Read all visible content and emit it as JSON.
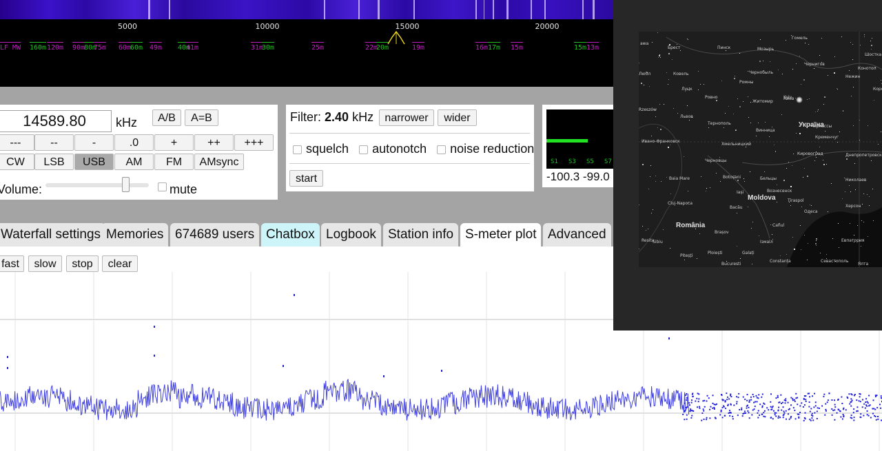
{
  "spectrum": {
    "scale_labels": [
      {
        "freq_khz": 5000,
        "label": "5000"
      },
      {
        "freq_khz": 10000,
        "label": "10000"
      },
      {
        "freq_khz": 15000,
        "label": "15000"
      },
      {
        "freq_khz": 20000,
        "label": "20000"
      }
    ],
    "band_labels": [
      {
        "text": "LF MW",
        "color": "magenta"
      },
      {
        "text": "160m",
        "color": "green"
      },
      {
        "text": "120m",
        "color": "magenta"
      },
      {
        "text": "90m",
        "color": "magenta"
      },
      {
        "text": "80m",
        "color": "green"
      },
      {
        "text": "75m",
        "color": "magenta"
      },
      {
        "text": "60m",
        "color": "magenta"
      },
      {
        "text": "60m",
        "color": "green"
      },
      {
        "text": "49m",
        "color": "magenta"
      },
      {
        "text": "40m",
        "color": "green"
      },
      {
        "text": "41m",
        "color": "magenta"
      },
      {
        "text": "31m",
        "color": "magenta"
      },
      {
        "text": "30m",
        "color": "green"
      },
      {
        "text": "25m",
        "color": "magenta"
      },
      {
        "text": "22m",
        "color": "magenta"
      },
      {
        "text": "20m",
        "color": "green"
      },
      {
        "text": "19m",
        "color": "magenta"
      },
      {
        "text": "16m",
        "color": "magenta"
      },
      {
        "text": "17m",
        "color": "green"
      },
      {
        "text": "15m",
        "color": "magenta"
      },
      {
        "text": "15m",
        "color": "green"
      },
      {
        "text": "13m",
        "color": "magenta"
      }
    ]
  },
  "frequency": {
    "value": "14589.80",
    "unit": "kHz",
    "ab_label": "A/B",
    "aeqb_label": "A=B"
  },
  "step_buttons": [
    "---",
    "--",
    "-",
    ".0",
    "+",
    "++",
    "+++"
  ],
  "modes": {
    "items": [
      "CW",
      "LSB",
      "USB",
      "AM",
      "FM",
      "AMsync"
    ],
    "selected": "USB"
  },
  "volume": {
    "label": "Volume:",
    "level": 0.78,
    "mute_label": "mute"
  },
  "filter": {
    "label": "Filter:",
    "value": "2.40",
    "unit": "kHz",
    "narrower_label": "narrower",
    "wider_label": "wider",
    "squelch_label": "squelch",
    "autonotch_label": "autonotch",
    "noise_label": "noise reduction",
    "start_label": "start"
  },
  "smeter": {
    "scale": [
      "S1",
      "S3",
      "S5",
      "S7"
    ],
    "readout": "-100.3 -99.0",
    "bar_color": "#22e322"
  },
  "tabs": [
    {
      "label": "Waterfall settings"
    },
    {
      "label": "Memories"
    },
    {
      "label": "674689 users"
    },
    {
      "label": "Chatbox"
    },
    {
      "label": "Logbook"
    },
    {
      "label": "Station info"
    },
    {
      "label": "S-meter plot"
    },
    {
      "label": "Advanced"
    }
  ],
  "active_tab": "S-meter plot",
  "plot_controls": {
    "fast": "fast",
    "slow": "slow",
    "stop": "stop",
    "clear": "clear"
  },
  "plot": {
    "point_color": "#1f1fd9"
  },
  "map": {
    "countries": [
      "Україна",
      "Moldova",
      "România"
    ],
    "cities": [
      "awa",
      "Брест",
      "Пинск",
      "Мозырь",
      "Гомель",
      "Шостка",
      "Конотоп",
      "Любл",
      "Ковель",
      "Чернобыль",
      "Чернигов",
      "Нежин",
      "Ромны",
      "Коростень",
      "Луцк",
      "Ровно",
      "Житомир",
      "Киев",
      "Львов",
      "Тернополь",
      "Винница",
      "Черкассы",
      "Кременчуг",
      "Хмельницкий",
      "Ивано-Франковск",
      "Rzeszów",
      "Черновцы",
      "Кировоград",
      "Днепропетровск",
      "Baia Mare",
      "Botoșani",
      "Бельцы",
      "Вознесенск",
      "Николаев",
      "Iași",
      "Cluj-Napoca",
      "Bacău",
      "Tiraspol",
      "Одеса",
      "Херсон",
      "Brașov",
      "Cahul",
      "Ізмаїл",
      "Евпатория",
      "Sibiu",
      "Ploiești",
      "Galați",
      "Севастополь",
      "Ялта",
      "Bucuresti",
      "Resita",
      "Pitești",
      "Constanța",
      "Kyiv"
    ]
  }
}
